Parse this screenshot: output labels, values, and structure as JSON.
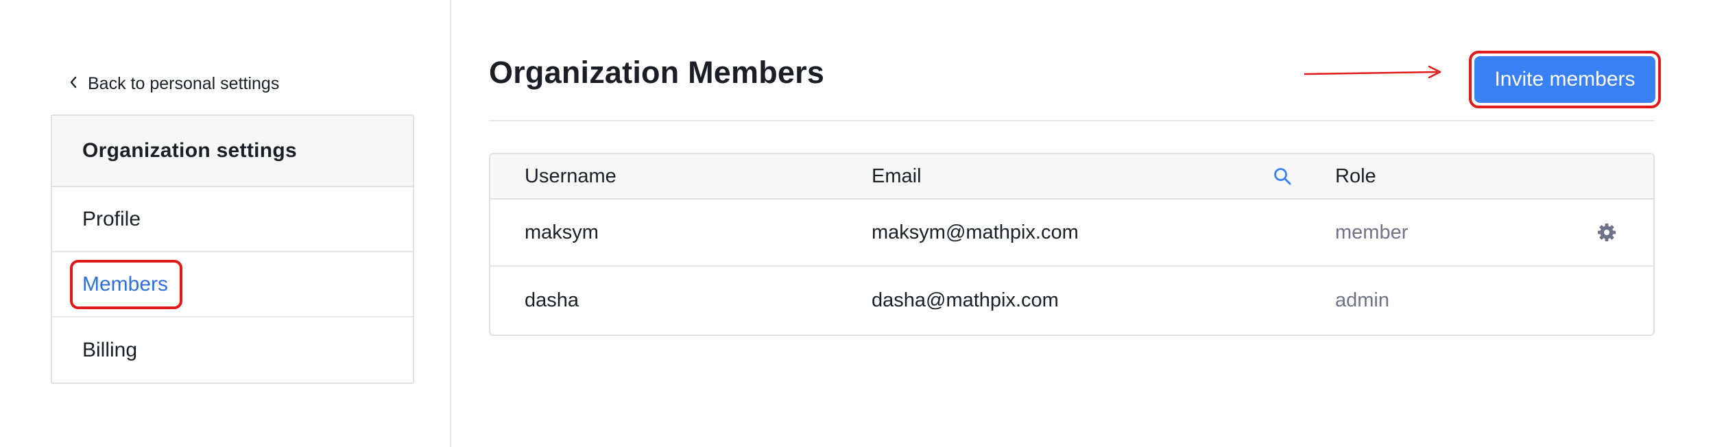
{
  "sidebar": {
    "back_link": "Back to personal settings",
    "card_title": "Organization settings",
    "items": [
      {
        "label": "Profile",
        "active": false
      },
      {
        "label": "Members",
        "active": true
      },
      {
        "label": "Billing",
        "active": false
      }
    ]
  },
  "main": {
    "title": "Organization Members",
    "invite_button": "Invite members"
  },
  "table": {
    "columns": {
      "username": "Username",
      "email": "Email",
      "role": "Role"
    },
    "rows": [
      {
        "username": "maksym",
        "email": "maksym@mathpix.com",
        "role": "member"
      },
      {
        "username": "dasha",
        "email": "dasha@mathpix.com",
        "role": "admin"
      }
    ]
  },
  "colors": {
    "accent_blue": "#3a80f5",
    "active_link": "#2f6fde",
    "annotation_red": "#e01919",
    "role_gray": "#6e7385"
  },
  "icons": [
    "chevron-left-icon",
    "search-icon",
    "gear-icon"
  ]
}
